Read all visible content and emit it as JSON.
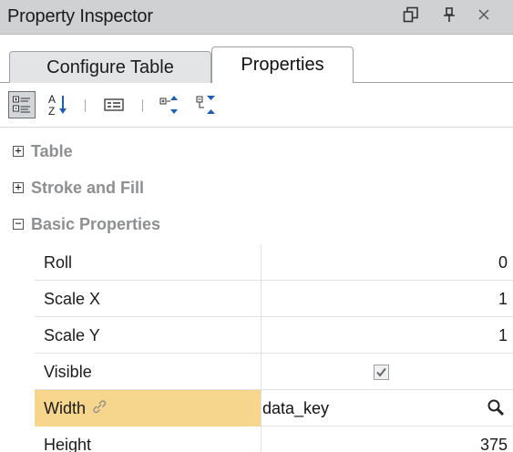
{
  "window": {
    "title": "Property Inspector",
    "float_glyph": "⧉",
    "pin_glyph": "ᚆ",
    "close_glyph": "✕"
  },
  "tabs": [
    {
      "label": "Configure Table",
      "active": false
    },
    {
      "label": "Properties",
      "active": true
    }
  ],
  "toolbar": {
    "alpha_icon_text": "A Z"
  },
  "groups": [
    {
      "label": "Table",
      "expanded": false,
      "toggle": "+"
    },
    {
      "label": "Stroke and Fill",
      "expanded": false,
      "toggle": "+"
    },
    {
      "label": "Basic Properties",
      "expanded": true,
      "toggle": "−"
    }
  ],
  "properties": [
    {
      "name": "Roll",
      "value": "0"
    },
    {
      "name": "Scale X",
      "value": "1"
    },
    {
      "name": "Scale Y",
      "value": "1"
    },
    {
      "name": "Visible",
      "value": "",
      "checked": true
    },
    {
      "name": "Width",
      "value": "data_key",
      "bound": true
    },
    {
      "name": "Height",
      "value": "375"
    }
  ],
  "colors": {
    "selected_row": "#f6d58c",
    "titlebar": "#cfd1d3",
    "group_text": "#8d8f91"
  }
}
